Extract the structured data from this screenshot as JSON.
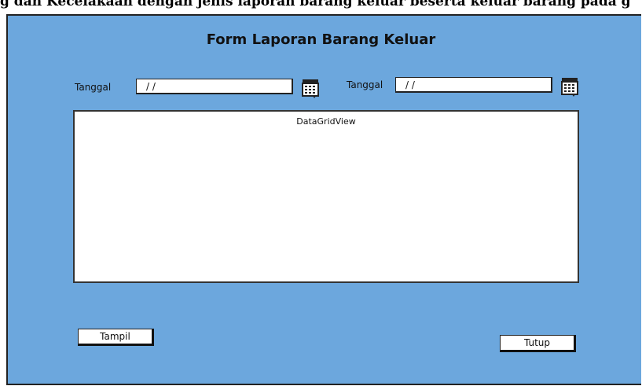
{
  "caption": "g dan Kecelakaan dengan jenis laporan barang keluar beserta keluar barang pada g",
  "form": {
    "title": "Form Laporan Barang Keluar",
    "date_from": {
      "label": "Tanggal",
      "value": "/ /"
    },
    "date_to": {
      "label": "Tanggal",
      "value": "/ /"
    },
    "grid_label": "DataGridView",
    "buttons": {
      "show": "Tampil",
      "close": "Tutup"
    }
  },
  "icons": {
    "calendar": "calendar-icon"
  },
  "colors": {
    "window_bg": "#6ca7dd",
    "field_bg": "#ffffff"
  }
}
